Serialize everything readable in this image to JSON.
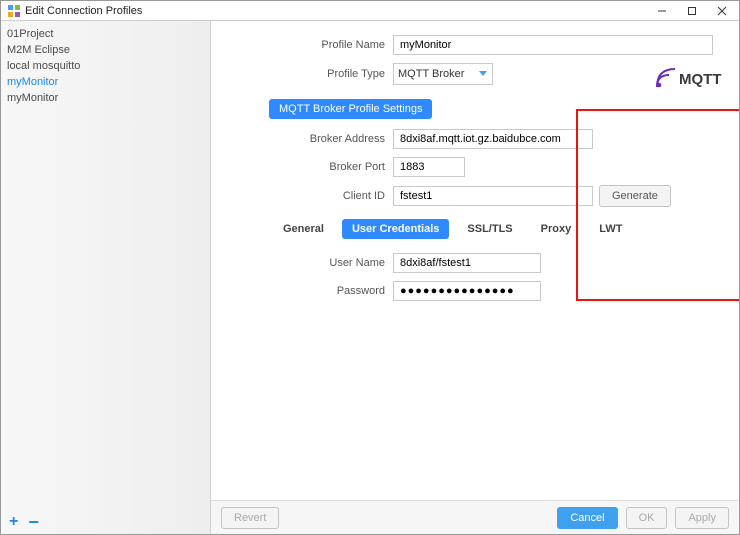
{
  "window": {
    "title": "Edit Connection Profiles"
  },
  "sidebar": {
    "items": [
      {
        "label": "01Project"
      },
      {
        "label": "M2M Eclipse"
      },
      {
        "label": "local mosquitto"
      },
      {
        "label": "myMonitor"
      },
      {
        "label": "myMonitor"
      }
    ],
    "selected_index": 3
  },
  "form": {
    "profile_name_label": "Profile Name",
    "profile_name": "myMonitor",
    "profile_type_label": "Profile Type",
    "profile_type": "MQTT Broker",
    "section_title": "MQTT Broker Profile Settings",
    "broker_address_label": "Broker Address",
    "broker_address": "8dxi8af.mqtt.iot.gz.baidubce.com",
    "broker_port_label": "Broker Port",
    "broker_port": "1883",
    "client_id_label": "Client ID",
    "client_id": "fstest1",
    "generate_label": "Generate"
  },
  "tabs": {
    "items": [
      "General",
      "User Credentials",
      "SSL/TLS",
      "Proxy",
      "LWT"
    ],
    "active_index": 1
  },
  "credentials": {
    "username_label": "User Name",
    "username": "8dxi8af/fstest1",
    "password_label": "Password",
    "password_masked": "●●●●●●●●●●●●●●●"
  },
  "footer": {
    "revert": "Revert",
    "cancel": "Cancel",
    "ok": "OK",
    "apply": "Apply"
  },
  "logo_alt": "MQTT"
}
